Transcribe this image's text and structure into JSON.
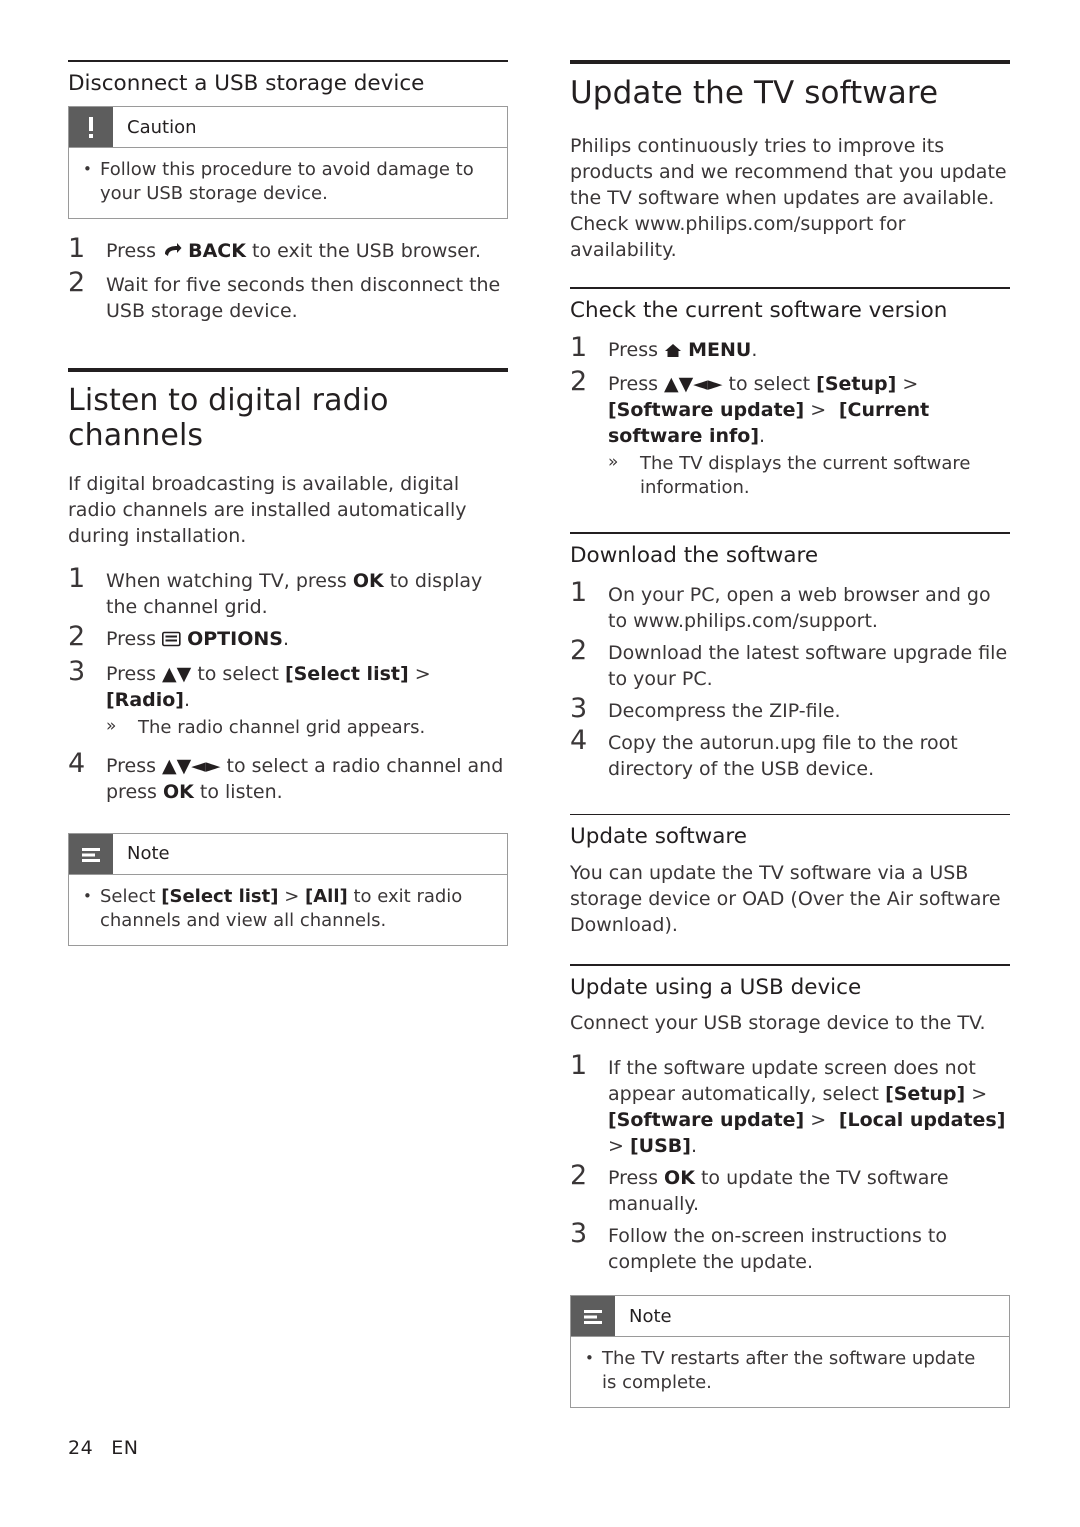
{
  "page": {
    "number": "24",
    "lang": "EN"
  },
  "left_column": {
    "section1": {
      "heading": "Disconnect a USB storage device",
      "caution": {
        "label": "Caution",
        "bullets": [
          "Follow this procedure to avoid damage to your USB storage device."
        ]
      },
      "steps": [
        {
          "num": "1",
          "pre": "Press ",
          "icon": "back-arrow-icon",
          "key": "BACK",
          "post": " to exit the USB browser."
        },
        {
          "num": "2",
          "pre": "",
          "icon": "",
          "key": "",
          "post": "Wait for five seconds then disconnect the USB storage device."
        }
      ]
    },
    "section2": {
      "heading": "Listen to digital radio channels",
      "intro": "If digital broadcasting is available, digital radio channels are installed automatically during installation.",
      "steps": [
        {
          "num": "1",
          "text_parts": [
            "When watching TV, press ",
            "OK",
            " to display the channel grid."
          ]
        },
        {
          "num": "2",
          "text_parts": [
            "Press ",
            "OPTIONS",
            "."
          ],
          "icon": "options-icon"
        },
        {
          "num": "3",
          "text_parts": [
            "Press ",
            "▲▼",
            " to select [Select list] > [Radio]."
          ],
          "subnote": "The radio channel grid appears."
        },
        {
          "num": "4",
          "text_parts": [
            "Press ",
            "▲▼◄►",
            " to select a radio channel and press ",
            "OK",
            " to listen."
          ]
        }
      ],
      "note": {
        "label": "Note",
        "bullets": [
          "Select [Select list] > [All] to exit radio channels and view all channels."
        ]
      }
    }
  },
  "right_column": {
    "title": "Update the TV software",
    "intro": "Philips continuously tries to improve its products and we recommend that you update the TV software when updates are available. Check www.philips.com/support for availability.",
    "section_check": {
      "heading": "Check the current software version",
      "steps": [
        {
          "num": "1",
          "text": "Press ⌂ MENU."
        },
        {
          "num": "2",
          "text": "Press ▲▼◄► to select [Setup] > [Software update] > [Current software info].",
          "subnote": "The TV displays the current software information."
        }
      ]
    },
    "section_download": {
      "heading": "Download the software",
      "steps": [
        {
          "num": "1",
          "text": "On your PC, open a web browser and go to www.philips.com/support."
        },
        {
          "num": "2",
          "text": "Download the latest software upgrade file to your PC."
        },
        {
          "num": "3",
          "text": "Decompress the ZIP-file."
        },
        {
          "num": "4",
          "text": "Copy the autorun.upg file to the root directory of the USB device."
        }
      ]
    },
    "section_update": {
      "heading": "Update software",
      "body": "You can update the TV software via a USB storage device or OAD (Over the Air software Download)."
    },
    "section_usb": {
      "heading": "Update using a USB device",
      "intro": "Connect your USB storage device to the TV.",
      "steps": [
        {
          "num": "1",
          "text": "If the software update screen does not appear automatically, select [Setup] > [Software update] > [Local updates] > [USB]."
        },
        {
          "num": "2",
          "text": "Press OK to update the TV software manually."
        },
        {
          "num": "3",
          "text": "Follow the on-screen instructions to complete the update."
        }
      ],
      "note": {
        "label": "Note",
        "bullets": [
          "The TV restarts after the software update is complete."
        ]
      }
    }
  }
}
